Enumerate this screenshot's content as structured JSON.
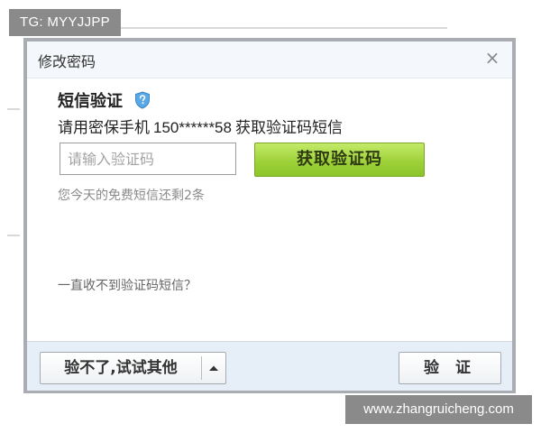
{
  "watermarks": {
    "top_left": "TG: MYYJJPP",
    "bottom_right": "www.zhangruicheng.com"
  },
  "dialog": {
    "title": "修改密码",
    "close_glyph": "×",
    "section_title": "短信验证",
    "section_icon": "shield-question-icon",
    "instruction_prefix": "请用密保手机",
    "masked_phone": "150******58",
    "instruction_suffix": "获取验证码短信",
    "code_input": {
      "value": "",
      "placeholder": "请输入验证码"
    },
    "get_code_label": "获取验证码",
    "sms_remaining": "您今天的免费短信还剩2条",
    "no_code_link": "一直收不到验证码短信？",
    "footer": {
      "other_label": "验不了,试试其他",
      "verify_label": "验 证"
    }
  },
  "colors": {
    "accent_green": "#9fd23a",
    "footer_bg": "#e6eef8",
    "shield_blue": "#5aa8e6"
  }
}
